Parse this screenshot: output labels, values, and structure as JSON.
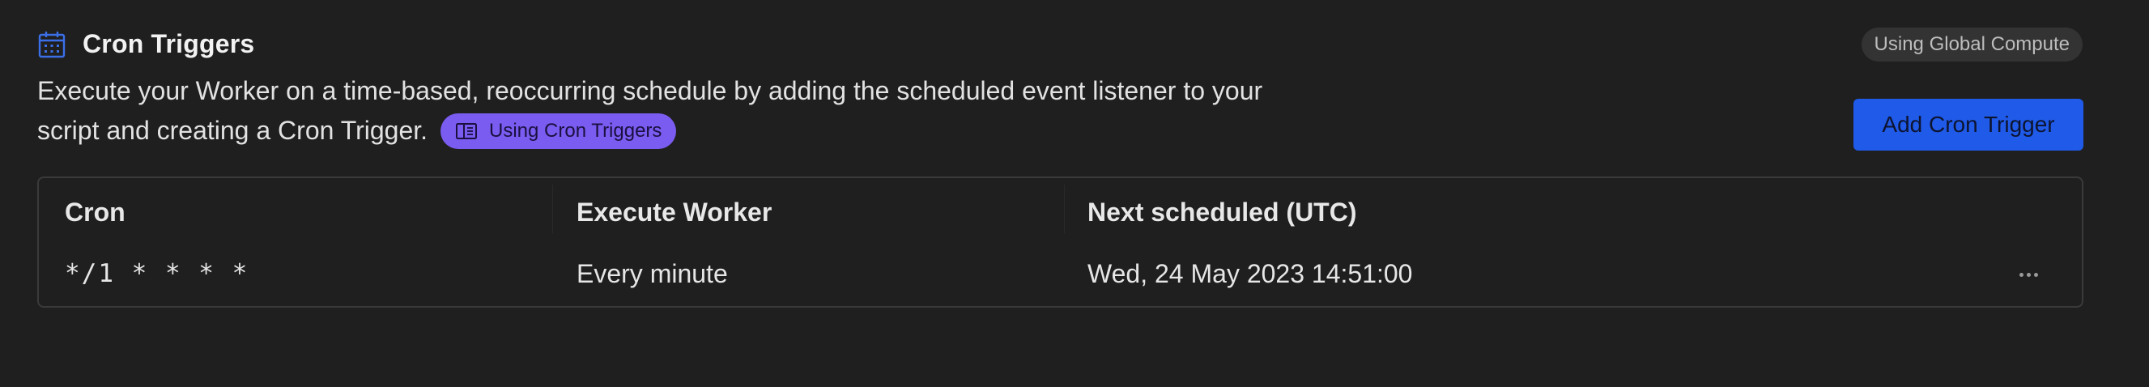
{
  "header": {
    "title": "Cron Triggers",
    "icon": "calendar-icon",
    "compute_badge": "Using Global Compute"
  },
  "description": {
    "line1": "Execute your Worker on a time-based, reoccurring schedule by adding the scheduled event listener to your",
    "line2": "script and creating a Cron Trigger.",
    "docs_link": "Using Cron Triggers",
    "docs_icon": "book-icon"
  },
  "actions": {
    "add_button": "Add Cron Trigger"
  },
  "table": {
    "columns": [
      "Cron",
      "Execute Worker",
      "Next scheduled (UTC)"
    ],
    "rows": [
      {
        "cron": "*/1 * * * *",
        "execute": "Every minute",
        "next": "Wed, 24 May 2023 14:51:00",
        "menu_icon": "more-horizontal-icon"
      }
    ]
  },
  "colors": {
    "background": "#1f1f1f",
    "accent": "#1f5ae8",
    "docs_pill": "#7a5cf0",
    "icon_blue": "#3b6fe8"
  }
}
